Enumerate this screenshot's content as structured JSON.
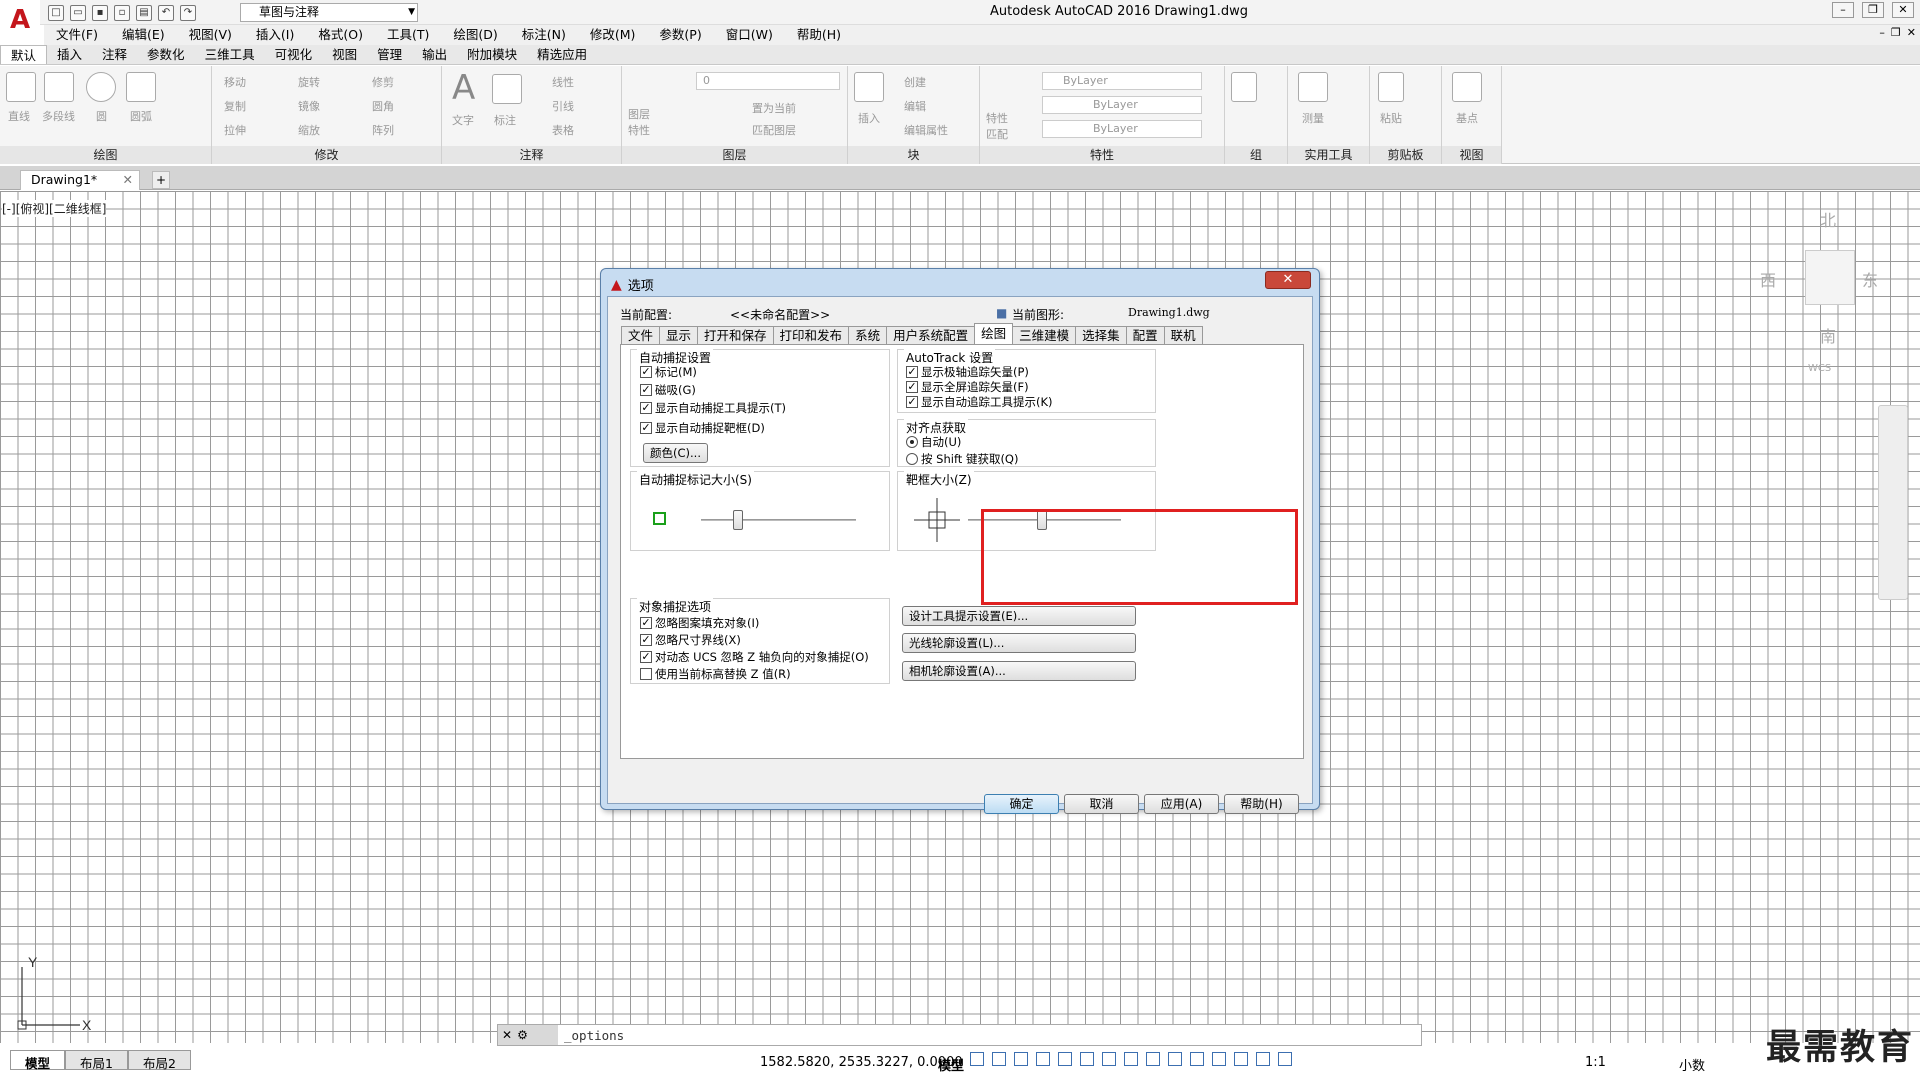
{
  "app": {
    "logo": "A",
    "workspace": "草图与注释",
    "window_title": "Autodesk AutoCAD 2016    Drawing1.dwg"
  },
  "menubar": [
    "文件(F)",
    "编辑(E)",
    "视图(V)",
    "插入(I)",
    "格式(O)",
    "工具(T)",
    "绘图(D)",
    "标注(N)",
    "修改(M)",
    "参数(P)",
    "窗口(W)",
    "帮助(H)"
  ],
  "ribbon_tabs": [
    "默认",
    "插入",
    "注释",
    "参数化",
    "三维工具",
    "可视化",
    "视图",
    "管理",
    "输出",
    "附加模块",
    "精选应用"
  ],
  "ribbon": {
    "draw_tools": [
      "直线",
      "多段线",
      "圆",
      "圆弧"
    ],
    "modify_tools": [
      "移动",
      "旋转",
      "修剪",
      "复制",
      "镜像",
      "圆角",
      "拉伸",
      "缩放",
      "阵列"
    ],
    "annotation_tools": [
      "文字",
      "标注",
      "线性",
      "引线",
      "表格"
    ],
    "layer_tools": [
      "图层特性",
      "置为当前",
      "匹配图层"
    ],
    "layer_value": "0",
    "block_tools": [
      "插入",
      "创建",
      "编辑",
      "编辑属性"
    ],
    "property_tools": [
      "特性匹配"
    ],
    "properties": [
      "ByLayer",
      "ByLayer",
      "ByLayer"
    ],
    "utility_tools": [
      "测量"
    ],
    "clipboard_tools": [
      "粘贴"
    ],
    "view_tools": [
      "基点"
    ],
    "panels": [
      "绘图",
      "修改",
      "注释",
      "图层",
      "块",
      "特性",
      "组",
      "实用工具",
      "剪贴板",
      "视图"
    ]
  },
  "doc_tab": "Drawing1*",
  "viewport_label": "[-][俯视][二维线框]",
  "viewcube": {
    "north": "北",
    "south": "南",
    "east": "东",
    "west": "西",
    "wcs": "WCS"
  },
  "ucs": {
    "y": "Y",
    "x": "X"
  },
  "layout_tabs": [
    "模型",
    "布局1",
    "布局2"
  ],
  "command_line": "_options",
  "status": {
    "coords": "1582.5820, 2535.3227, 0.0000",
    "model": "模型",
    "scale": "1:1",
    "decimal": "小数"
  },
  "watermark": "最需教育",
  "dialog": {
    "title": "选项",
    "current_profile_label": "当前配置:",
    "current_profile_value": "<<未命名配置>>",
    "current_drawing_label": "当前图形:",
    "current_drawing_value": "Drawing1.dwg",
    "tabs": [
      "文件",
      "显示",
      "打开和保存",
      "打印和发布",
      "系统",
      "用户系统配置",
      "绘图",
      "三维建模",
      "选择集",
      "配置",
      "联机"
    ],
    "active_tab": "绘图",
    "autosnap_title": "自动捕捉设置",
    "autosnap": [
      {
        "label": "标记(M)",
        "checked": true
      },
      {
        "label": "磁吸(G)",
        "checked": true
      },
      {
        "label": "显示自动捕捉工具提示(T)",
        "checked": true
      },
      {
        "label": "显示自动捕捉靶框(D)",
        "checked": true
      }
    ],
    "color_button": "颜色(C)...",
    "autotrack_title": "AutoTrack 设置",
    "autotrack": [
      {
        "label": "显示极轴追踪矢量(P)",
        "checked": true
      },
      {
        "label": "显示全屏追踪矢量(F)",
        "checked": true
      },
      {
        "label": "显示自动追踪工具提示(K)",
        "checked": true
      }
    ],
    "alignment_title": "对齐点获取",
    "alignment": [
      {
        "label": "自动(U)",
        "selected": true
      },
      {
        "label": "按 Shift 键获取(Q)",
        "selected": false
      }
    ],
    "marker_size_title": "自动捕捉标记大小(S)",
    "marker_size_level": 0.22,
    "aperture_size_title": "靶框大小(Z)",
    "aperture_size_level": 0.48,
    "osnap_title": "对象捕捉选项",
    "osnap": [
      {
        "label": "忽略图案填充对象(I)",
        "checked": true
      },
      {
        "label": "忽略尺寸界线(X)",
        "checked": true
      },
      {
        "label": "对动态 UCS 忽略 Z 轴负向的对象捕捉(O)",
        "checked": true
      },
      {
        "label": "使用当前标高替换 Z 值(R)",
        "checked": false
      }
    ],
    "setting_buttons": [
      "设计工具提示设置(E)...",
      "光线轮廓设置(L)...",
      "相机轮廓设置(A)..."
    ],
    "buttons": {
      "ok": "确定",
      "cancel": "取消",
      "apply": "应用(A)",
      "help": "帮助(H)"
    },
    "close": "✕",
    "colors": {
      "highlight": "#e02020"
    }
  }
}
